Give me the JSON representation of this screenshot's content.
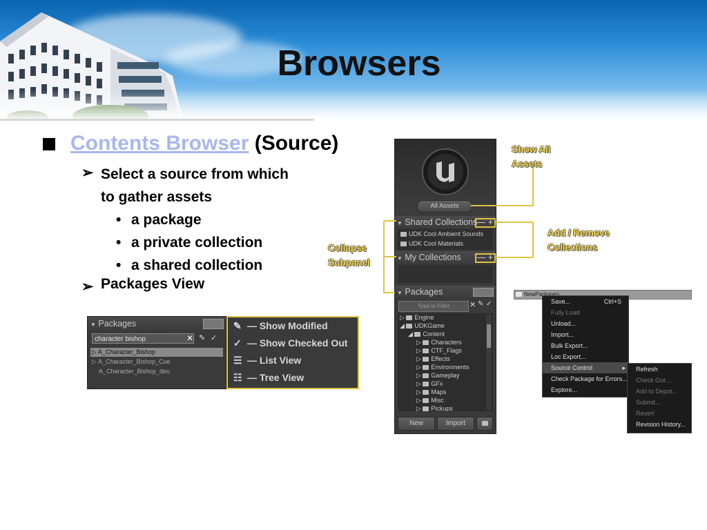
{
  "slide": {
    "title": "Browsers",
    "bullet_main_link": "Contents Browser",
    "bullet_main_rest": "(Source)",
    "sub1_line1": "Select a source from which",
    "sub1_line2": "to gather assets",
    "sub_items": [
      "a package",
      "a private collection",
      "a shared collection"
    ],
    "sub2": "Packages View"
  },
  "callouts": {
    "show_all_1": "Show All",
    "show_all_2": "Assets",
    "add_remove_1": "Add / Remove",
    "add_remove_2": "Collections",
    "collapse_1": "Collapse",
    "collapse_2": "Subpanel"
  },
  "browser": {
    "all_assets": "All Assets",
    "shared_collections": "Shared Collections",
    "shared_items": [
      "UDK Cool Ambient Sounds",
      "UDK Cool Materials"
    ],
    "my_collections": "My Collections",
    "packages": "Packages",
    "filter_placeholder": "Type to Filter",
    "tree": {
      "engine": "Engine",
      "udkgame": "UDKGame",
      "content": "Content",
      "children": [
        "Characters",
        "CTF_Flags",
        "Effects",
        "Environments",
        "Gameplay",
        "GFx",
        "Maps",
        "Misc",
        "Pickups"
      ]
    },
    "new_button": "New",
    "import_button": "Import"
  },
  "packages_view": {
    "header": "Packages",
    "search_value": "character  bishop",
    "rows": [
      "A_Character_Bishop",
      "A_Character_Bishop_Cue",
      "A_Character_Bishop_deu"
    ],
    "options": [
      "Show Modified",
      "Show Checked Out",
      "List View",
      "Tree View"
    ]
  },
  "context_menu": {
    "title": "NewPackages",
    "items": [
      {
        "label": "Save...",
        "shortcut": "Ctrl+S",
        "disabled": false
      },
      {
        "label": "Fully Load",
        "shortcut": "",
        "disabled": true
      },
      {
        "label": "Unload...",
        "shortcut": "",
        "disabled": false
      },
      {
        "label": "Import...",
        "shortcut": "",
        "disabled": false
      },
      {
        "label": "Bulk Export...",
        "shortcut": "",
        "disabled": false
      },
      {
        "label": "Loc Export...",
        "shortcut": "",
        "disabled": false
      },
      {
        "label": "Source Control",
        "shortcut": "",
        "disabled": false
      },
      {
        "label": "Check Package for Errors...",
        "shortcut": "",
        "disabled": false
      },
      {
        "label": "Explore...",
        "shortcut": "",
        "disabled": false
      }
    ],
    "submenu": [
      {
        "label": "Refresh",
        "disabled": false
      },
      {
        "label": "Check Out...",
        "disabled": true
      },
      {
        "label": "Add to Depot...",
        "disabled": true
      },
      {
        "label": "Submit...",
        "disabled": true
      },
      {
        "label": "Revert",
        "disabled": true
      },
      {
        "label": "Revision History...",
        "disabled": false
      }
    ]
  },
  "colors": {
    "accent_yellow": "#e0c440",
    "link": "#a9b7ee",
    "panel_bg": "#3a3a3a"
  }
}
